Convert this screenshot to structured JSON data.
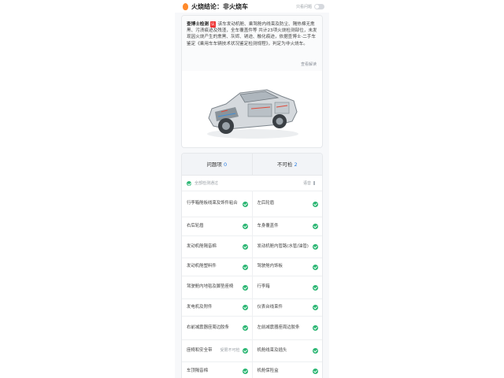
{
  "header": {
    "title": "火烧结论：非火烧车",
    "toggle_label": "只看问题"
  },
  "description": {
    "bold_prefix": "查博士检测",
    "brand_tag": "认",
    "text": "该车发动机舱、乘驾舱内线束及防尘、隔热棉无熏黑、污渍痕迹及残渣，全车覆盖件等 共计23项火烧检测部位，未发现因火烧产生的熏黑、灰烬、锈迹、融化痕迹，依据查博士·二手车鉴定《乘用车车辆技术状况鉴定检测规程》，判定为非火烧车。",
    "view_more": "查看解读"
  },
  "car_image": {
    "icon": "car-cutaway-illustration"
  },
  "table": {
    "tab_left": {
      "label": "问题项",
      "count": "0"
    },
    "tab_right": {
      "label": "不可检",
      "count": "2"
    },
    "summary": "全部检测通过",
    "summary_right": "语音",
    "rows": [
      {
        "left": "行李箱舱板线束及饰件粘合",
        "right": "左后轮眉"
      },
      {
        "left": "右后轮眉",
        "right": "车身覆盖件"
      },
      {
        "left": "发动机舱隔音棉",
        "right": "发动机舱内管路(水管/油管)"
      },
      {
        "left": "发动机舱塑料件",
        "right": "驾驶舱内饰板"
      },
      {
        "left": "驾驶舱内地毯及脚垫座椅",
        "right": "行李箱"
      },
      {
        "left": "发电机及附件",
        "right": "仪表台线束件"
      },
      {
        "left": "右前减震器座周边胶条",
        "right": "左前减震器座周边胶条"
      },
      {
        "left": "座椅和安全带",
        "right": "机舱线束及插头"
      },
      {
        "left": "车顶隔音棉",
        "right": "机舱保险盒"
      }
    ],
    "unable_tag": "受限不可检"
  },
  "colors": {
    "ok": "#2bb673",
    "accent": "#2a7de1",
    "fire": "#ff8a2b"
  }
}
